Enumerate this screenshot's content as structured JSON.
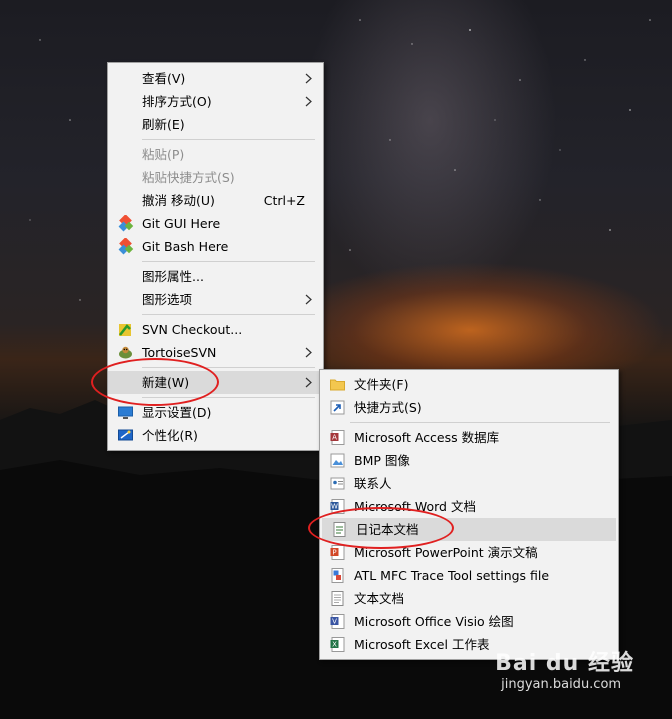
{
  "context_menu": {
    "items": [
      {
        "label": "查看(V)"
      },
      {
        "label": "排序方式(O)"
      },
      {
        "label": "刷新(E)"
      },
      {
        "label": "粘贴(P)"
      },
      {
        "label": "粘贴快捷方式(S)"
      },
      {
        "label": "撤消 移动(U)",
        "accel": "Ctrl+Z"
      },
      {
        "label": "Git GUI Here"
      },
      {
        "label": "Git Bash Here"
      },
      {
        "label": "图形属性..."
      },
      {
        "label": "图形选项"
      },
      {
        "label": "SVN Checkout..."
      },
      {
        "label": "TortoiseSVN"
      },
      {
        "label": "新建(W)"
      },
      {
        "label": "显示设置(D)"
      },
      {
        "label": "个性化(R)"
      }
    ]
  },
  "new_submenu": {
    "items": [
      {
        "label": "文件夹(F)"
      },
      {
        "label": "快捷方式(S)"
      },
      {
        "label": "Microsoft Access 数据库"
      },
      {
        "label": "BMP 图像"
      },
      {
        "label": "联系人"
      },
      {
        "label": "Microsoft Word 文档"
      },
      {
        "label": "日记本文档"
      },
      {
        "label": "Microsoft PowerPoint 演示文稿"
      },
      {
        "label": "ATL MFC Trace Tool settings file"
      },
      {
        "label": "文本文档"
      },
      {
        "label": "Microsoft Office Visio 绘图"
      },
      {
        "label": "Microsoft Excel 工作表"
      }
    ]
  },
  "watermark": {
    "brand": "Bai du 经验",
    "url": "jingyan.baidu.com"
  },
  "colors": {
    "menu_bg": "#f2f2f2",
    "highlight": "#dadada",
    "annotation": "#e02020"
  }
}
